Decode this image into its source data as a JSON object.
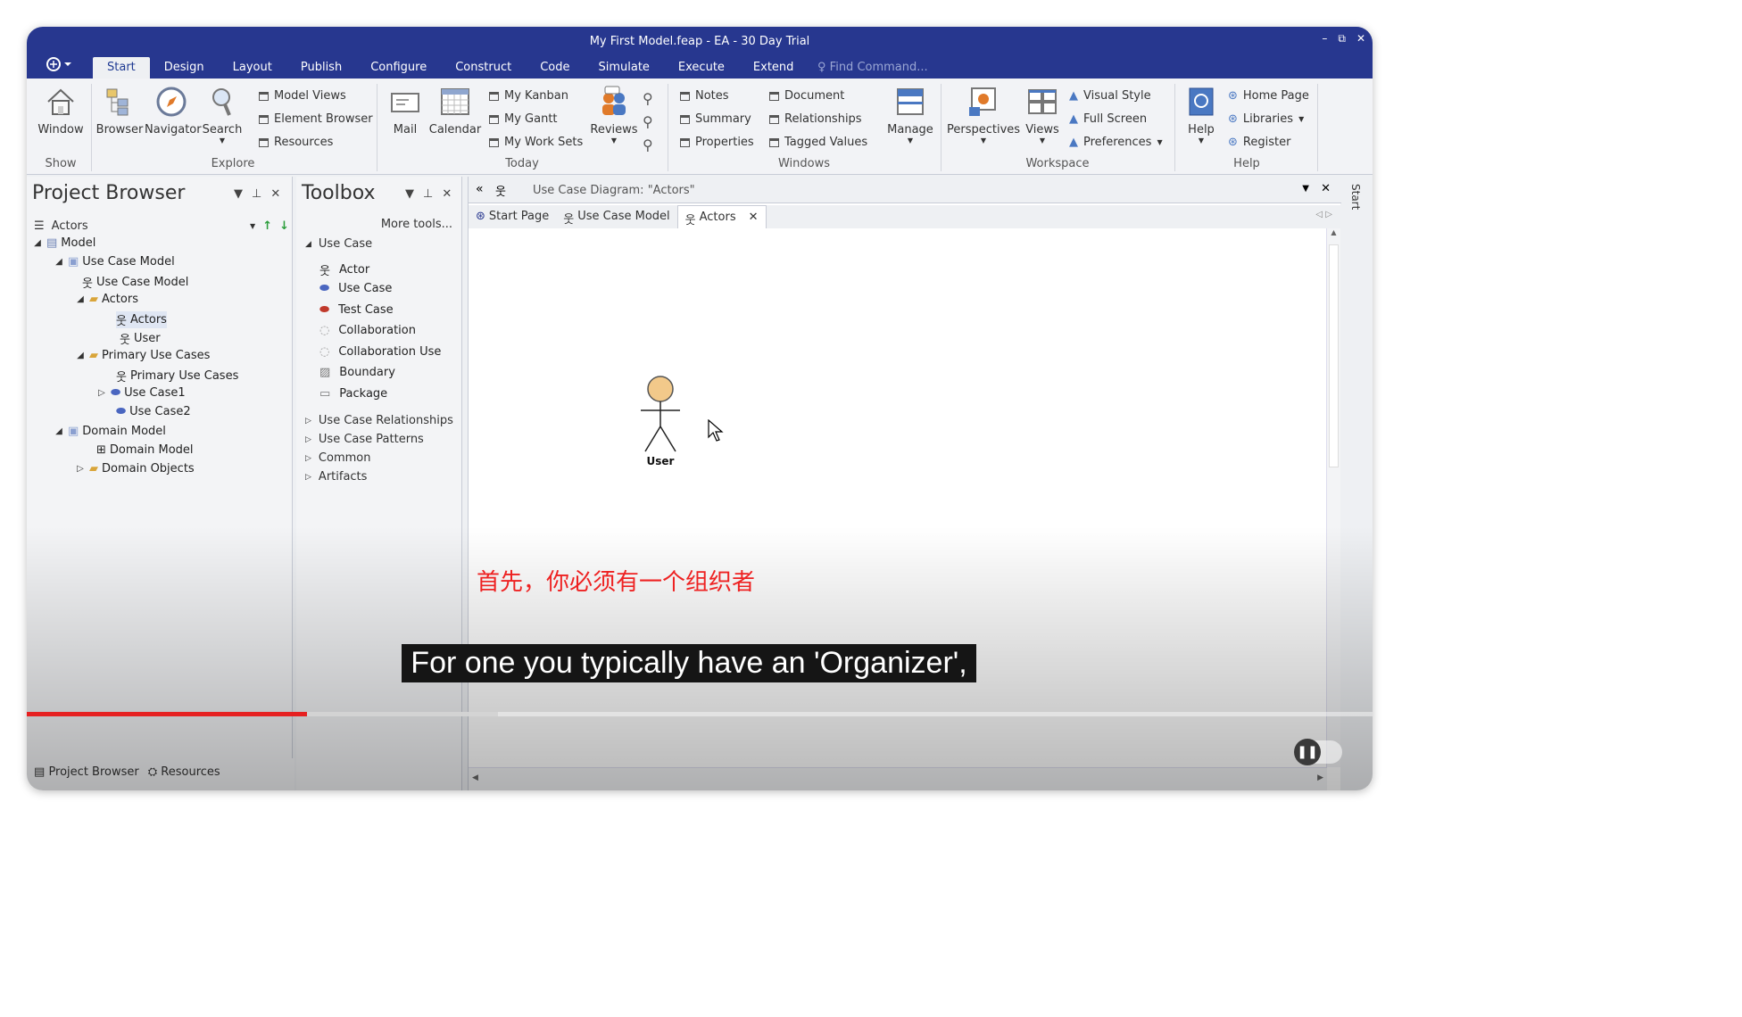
{
  "window": {
    "title": "My First Model.feap - EA - 30 Day Trial",
    "controls": [
      "–",
      "⧉",
      "✕"
    ]
  },
  "ribbon_tabs": [
    "Start",
    "Design",
    "Layout",
    "Publish",
    "Configure",
    "Construct",
    "Code",
    "Simulate",
    "Execute",
    "Extend"
  ],
  "find_command": "Find Command...",
  "ribbon": {
    "show": {
      "window": "Window",
      "group": "Show"
    },
    "explore": {
      "browser": "Browser",
      "navigator": "Navigator",
      "search": "Search",
      "model_views": "Model Views",
      "element_browser": "Element Browser",
      "resources": "Resources",
      "group": "Explore"
    },
    "today": {
      "mail": "Mail",
      "calendar": "Calendar",
      "my_kanban": "My Kanban",
      "my_gantt": "My Gantt",
      "my_work_sets": "My Work Sets",
      "reviews": "Reviews",
      "group": "Today"
    },
    "windows": {
      "notes": "Notes",
      "summary": "Summary",
      "properties": "Properties",
      "document": "Document",
      "relationships": "Relationships",
      "tagged_values": "Tagged Values",
      "manage": "Manage",
      "group": "Windows"
    },
    "workspace": {
      "perspectives": "Perspectives",
      "views": "Views",
      "visual_style": "Visual Style",
      "full_screen": "Full Screen",
      "preferences": "Preferences",
      "group": "Workspace"
    },
    "help": {
      "help": "Help",
      "home_page": "Home Page",
      "libraries": "Libraries",
      "register": "Register",
      "group": "Help"
    }
  },
  "project_browser": {
    "title": "Project Browser",
    "current": "Actors",
    "tree": [
      {
        "label": "Model",
        "twisty": "◢"
      },
      {
        "label": "Use Case Model",
        "twisty": "◢"
      },
      {
        "label": "Use Case Model",
        "twisty": ""
      },
      {
        "label": "Actors",
        "twisty": "◢"
      },
      {
        "label": "Actors",
        "twisty": ""
      },
      {
        "label": "User",
        "twisty": ""
      },
      {
        "label": "Primary Use Cases",
        "twisty": "◢"
      },
      {
        "label": "Primary Use Cases",
        "twisty": ""
      },
      {
        "label": "Use Case1",
        "twisty": "▷"
      },
      {
        "label": "Use Case2",
        "twisty": ""
      },
      {
        "label": "Domain Model",
        "twisty": "◢"
      },
      {
        "label": "Domain Model",
        "twisty": ""
      },
      {
        "label": "Domain Objects",
        "twisty": "▷"
      }
    ]
  },
  "toolbox": {
    "title": "Toolbox",
    "more_tools": "More tools...",
    "section": "Use Case",
    "items": [
      "Actor",
      "Use Case",
      "Test Case",
      "Collaboration",
      "Collaboration Use",
      "Boundary",
      "Package"
    ],
    "collapsed_sections": [
      "Use Case Relationships",
      "Use Case Patterns",
      "Common",
      "Artifacts"
    ]
  },
  "diagram": {
    "header": "Use Case Diagram: \"Actors\"",
    "tabs": [
      "Start Page",
      "Use Case Model",
      "Actors"
    ],
    "actor_label": "User"
  },
  "right_strip_label": "Start",
  "bottom_tabs": [
    "Project Browser",
    "Resources"
  ],
  "subtitles": {
    "chinese": "首先，你必须有一个组织者",
    "english": "For one you typically have an 'Organizer',"
  },
  "video": {
    "progress_played": 0.208,
    "progress_buffered": 0.35
  },
  "colors": {
    "titlebar": "#27378f",
    "accent": "#1f3a93",
    "progress_red": "#e62020",
    "subtitle_red": "#ee2222"
  }
}
